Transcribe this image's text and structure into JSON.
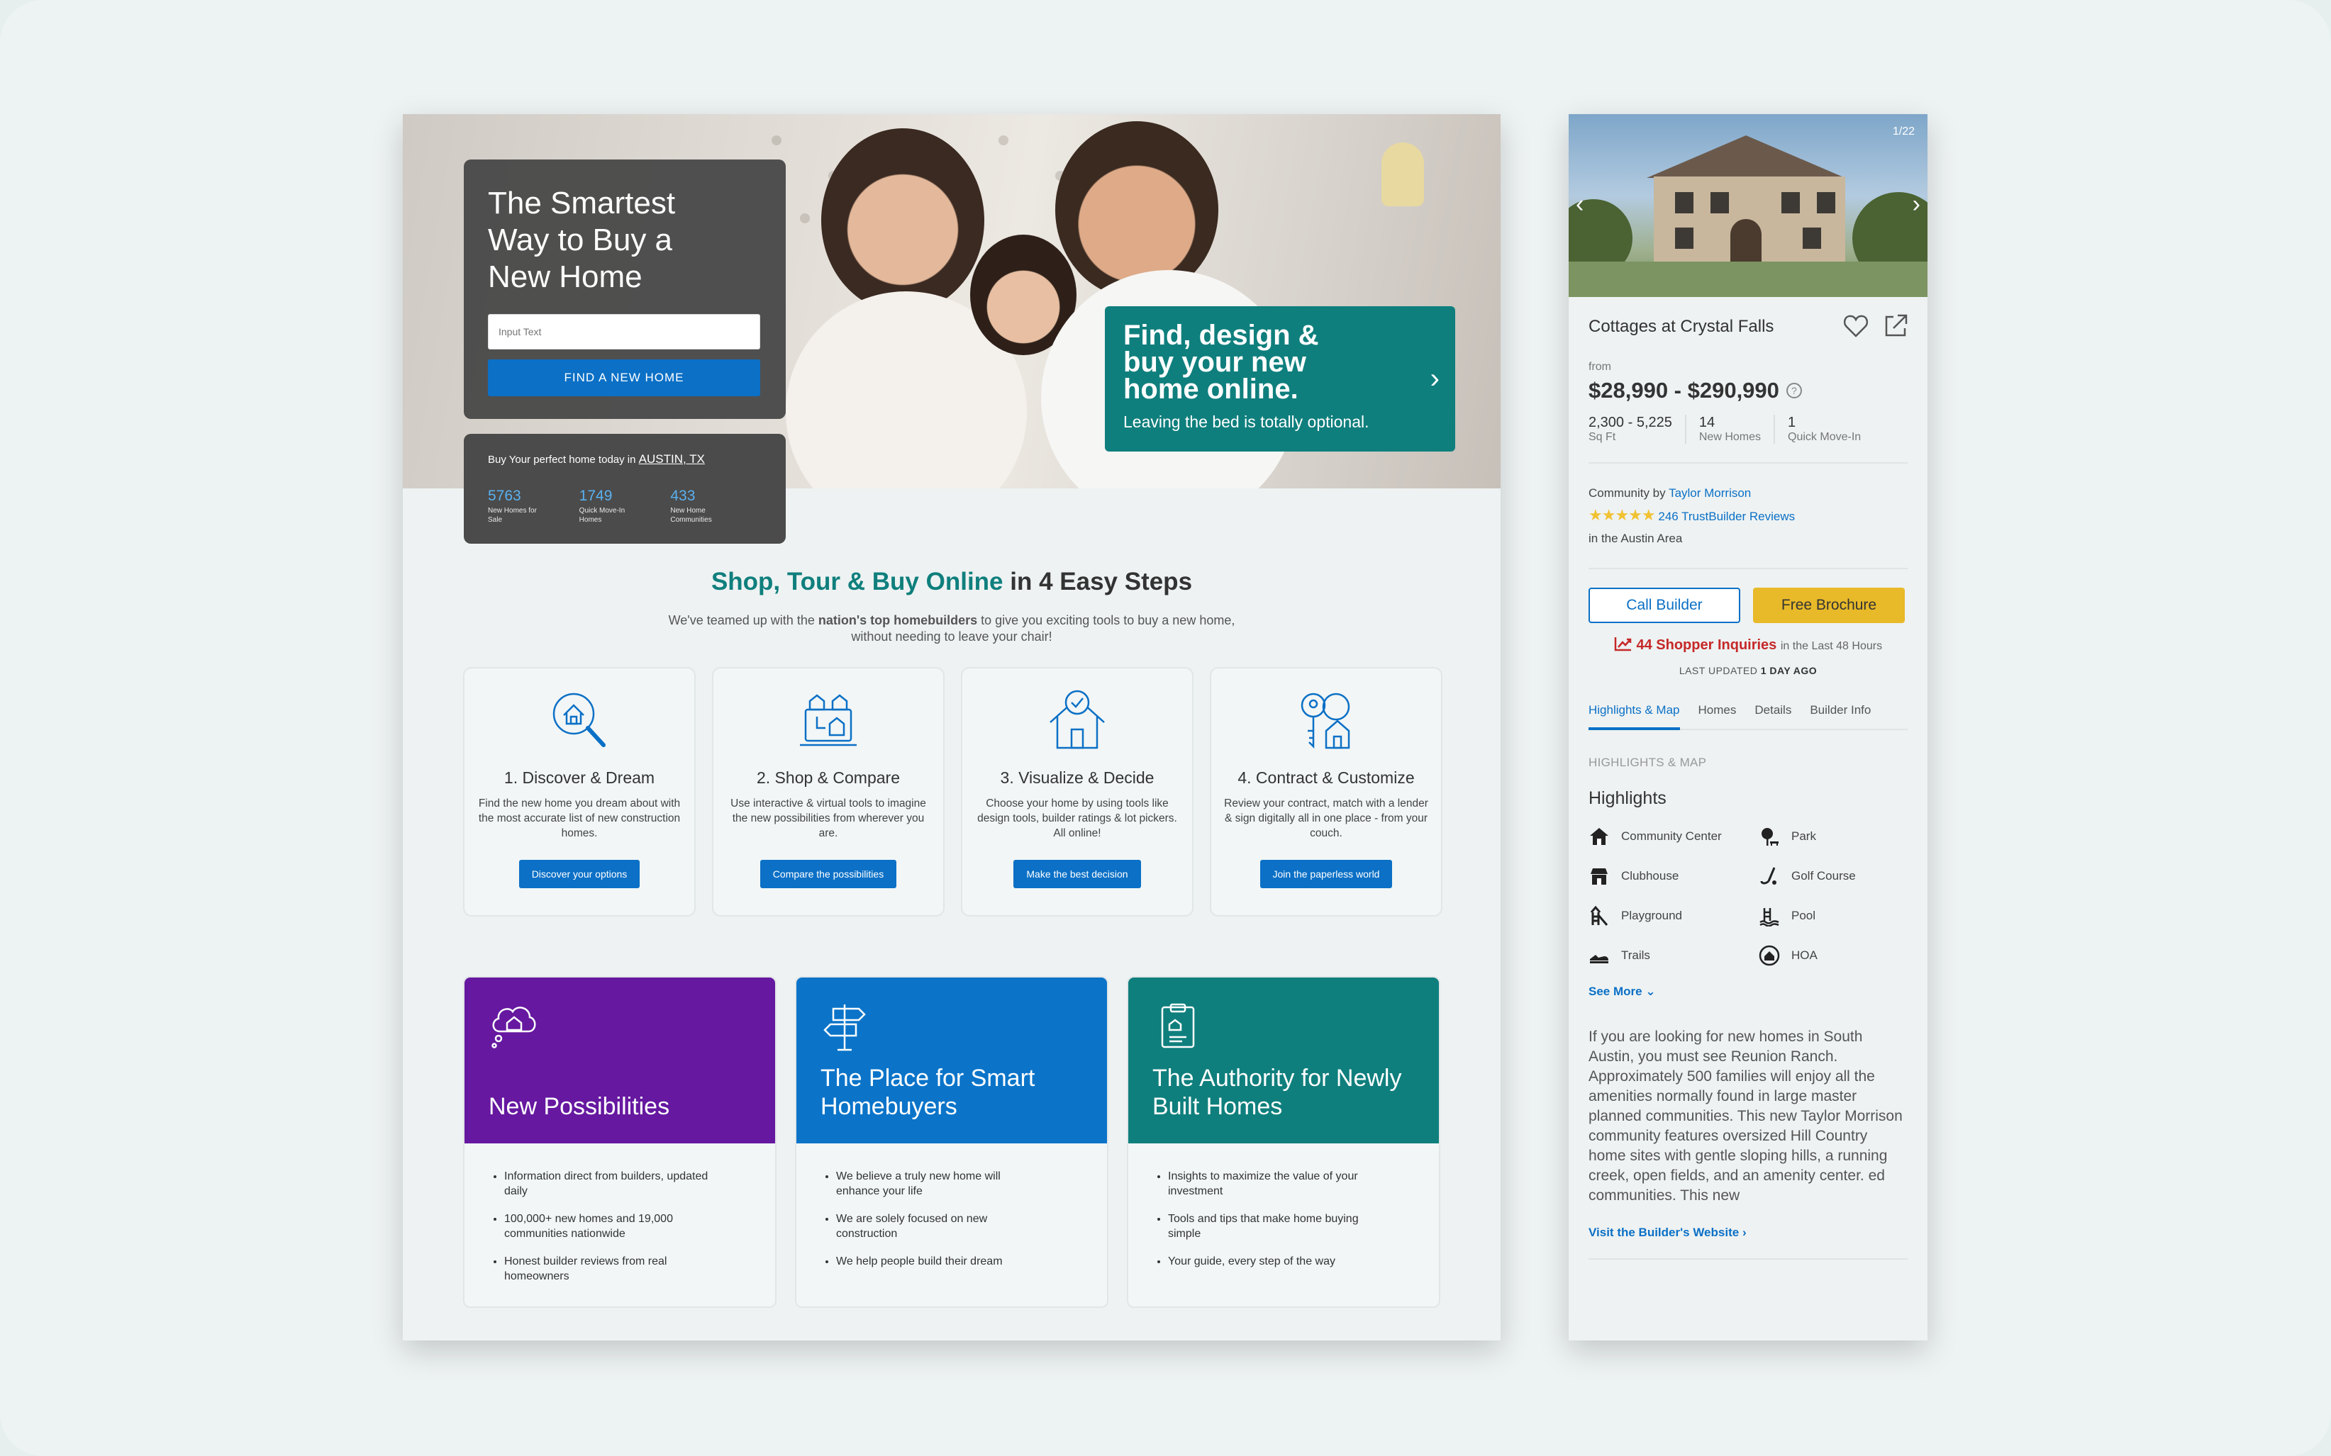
{
  "hero": {
    "title": "The Smartest Way to Buy a New Home",
    "search_placeholder": "Input Text",
    "find_button": "FIND A NEW HOME",
    "location_prefix": "Buy Your perfect home today in",
    "location": "AUSTIN, TX",
    "stats": [
      {
        "value": "5763",
        "label": "New Homes for Sale"
      },
      {
        "value": "1749",
        "label": "Quick Move-In Homes"
      },
      {
        "value": "433",
        "label": "New Home Communities"
      }
    ],
    "promo_title": "Find, design & buy your new home online.",
    "promo_sub": "Leaving the bed is totally optional."
  },
  "steps": {
    "heading_highlight": "Shop, Tour & Buy Online",
    "heading_rest": " in 4 Easy Steps",
    "sub_a": "We've teamed up with the ",
    "sub_bold": "nation's top homebuilders",
    "sub_b": " to give you exciting tools to buy a new home, without needing to leave your chair!",
    "items": [
      {
        "icon": "search-home-icon",
        "title": "1. Discover & Dream",
        "desc": "Find the new home you dream about with the most accurate list of new construction homes.",
        "button": "Discover your options"
      },
      {
        "icon": "compare-icon",
        "title": "2. Shop & Compare",
        "desc": "Use interactive & virtual tools to imagine the new possibilities from wherever you are.",
        "button": "Compare the possibilities"
      },
      {
        "icon": "house-check-icon",
        "title": "3. Visualize & Decide",
        "desc": "Choose your home by using tools like design tools, builder ratings & lot pickers. All online!",
        "button": "Make the best decision"
      },
      {
        "icon": "keys-icon",
        "title": "4. Contract & Customize",
        "desc": "Review your contract, match with a lender & sign digitally all in one place - from your couch.",
        "button": "Join the paperless world"
      }
    ]
  },
  "features": [
    {
      "title": "New Possibilities",
      "color": "#6618a0",
      "icon": "thought-home-icon",
      "bullets": [
        "Information direct from builders, updated daily",
        "100,000+ new homes and 19,000 communities nationwide",
        "Honest builder reviews from real homeowners"
      ]
    },
    {
      "title": "The Place for Smart Homebuyers",
      "color": "#0b74c9",
      "icon": "signpost-icon",
      "bullets": [
        "We believe a truly new home will enhance your life",
        "We are solely focused on new construction",
        "We help people build their dream"
      ]
    },
    {
      "title": "The Authority for Newly Built Homes",
      "color": "#0f7f7d",
      "icon": "clipboard-icon",
      "bullets": [
        "Insights to maximize the value of your investment",
        "Tools and tips that make home buying simple",
        "Your guide, every step of the way"
      ]
    }
  ],
  "listing": {
    "photo_counter": "1/22",
    "name": "Cottages at Crystal Falls",
    "from_label": "from",
    "price": "$28,990 - $290,990",
    "specs": [
      {
        "value": "2,300 - 5,225",
        "label": "Sq Ft"
      },
      {
        "value": "14",
        "label": "New Homes"
      },
      {
        "value": "1",
        "label": "Quick Move-In"
      }
    ],
    "community_by": "Community by",
    "builder": "Taylor Morrison",
    "stars": "★★★★★",
    "reviews": "246 TrustBuilder Reviews",
    "area": "in the Austin Area",
    "call_button": "Call Builder",
    "brochure_button": "Free Brochure",
    "inquiries": "44 Shopper Inquiries",
    "inquiries_suffix": "in the Last 48 Hours",
    "updated_label": "LAST UPDATED",
    "updated_value": "1 DAY AGO",
    "tabs": [
      "Highlights & Map",
      "Homes",
      "Details",
      "Builder Info"
    ],
    "section_label": "HIGHLIGHTS & MAP",
    "highlights_title": "Highlights",
    "highlights": [
      "Community Center",
      "Park",
      "Clubhouse",
      "Golf Course",
      "Playground",
      "Pool",
      "Trails",
      "HOA"
    ],
    "see_more": "See More",
    "description": "If you are looking for new homes in South Austin, you must see Reunion Ranch. Approximately 500 families will enjoy all the amenities normally found in large master planned communities. This new Taylor Morrison community features oversized Hill Country home sites with gentle sloping hills, a running creek, open fields, and an amenity center. ed communities. This new",
    "visit_link": "Visit the Builder's Website"
  }
}
